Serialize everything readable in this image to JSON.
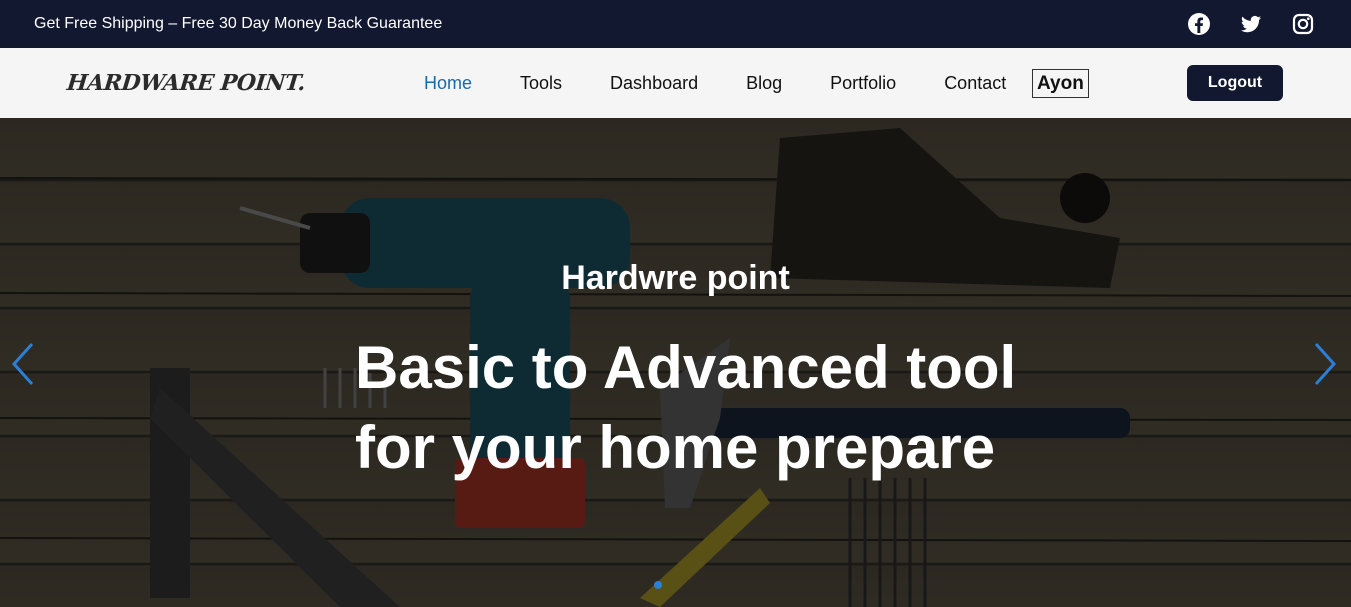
{
  "topbar": {
    "promo_text": "Get Free Shipping – Free 30 Day Money Back Guarantee",
    "social": [
      {
        "icon": "facebook-icon"
      },
      {
        "icon": "twitter-icon"
      },
      {
        "icon": "instagram-icon"
      }
    ]
  },
  "navbar": {
    "logo_text": "HARDWARE POINT.",
    "links": [
      "Home",
      "Tools",
      "Dashboard",
      "Blog",
      "Portfolio",
      "Contact"
    ],
    "active_link": "Home",
    "user_name": "Ayon",
    "logout_label": "Logout"
  },
  "hero": {
    "subtitle": "Hardwre point",
    "title": "Basic to Advanced tool for your home prepare",
    "prev_icon": "chevron-left-icon",
    "next_icon": "chevron-right-icon"
  },
  "colors": {
    "dark": "#121830",
    "active_link": "#1b6aa8",
    "arrow": "#2b7fd6"
  }
}
